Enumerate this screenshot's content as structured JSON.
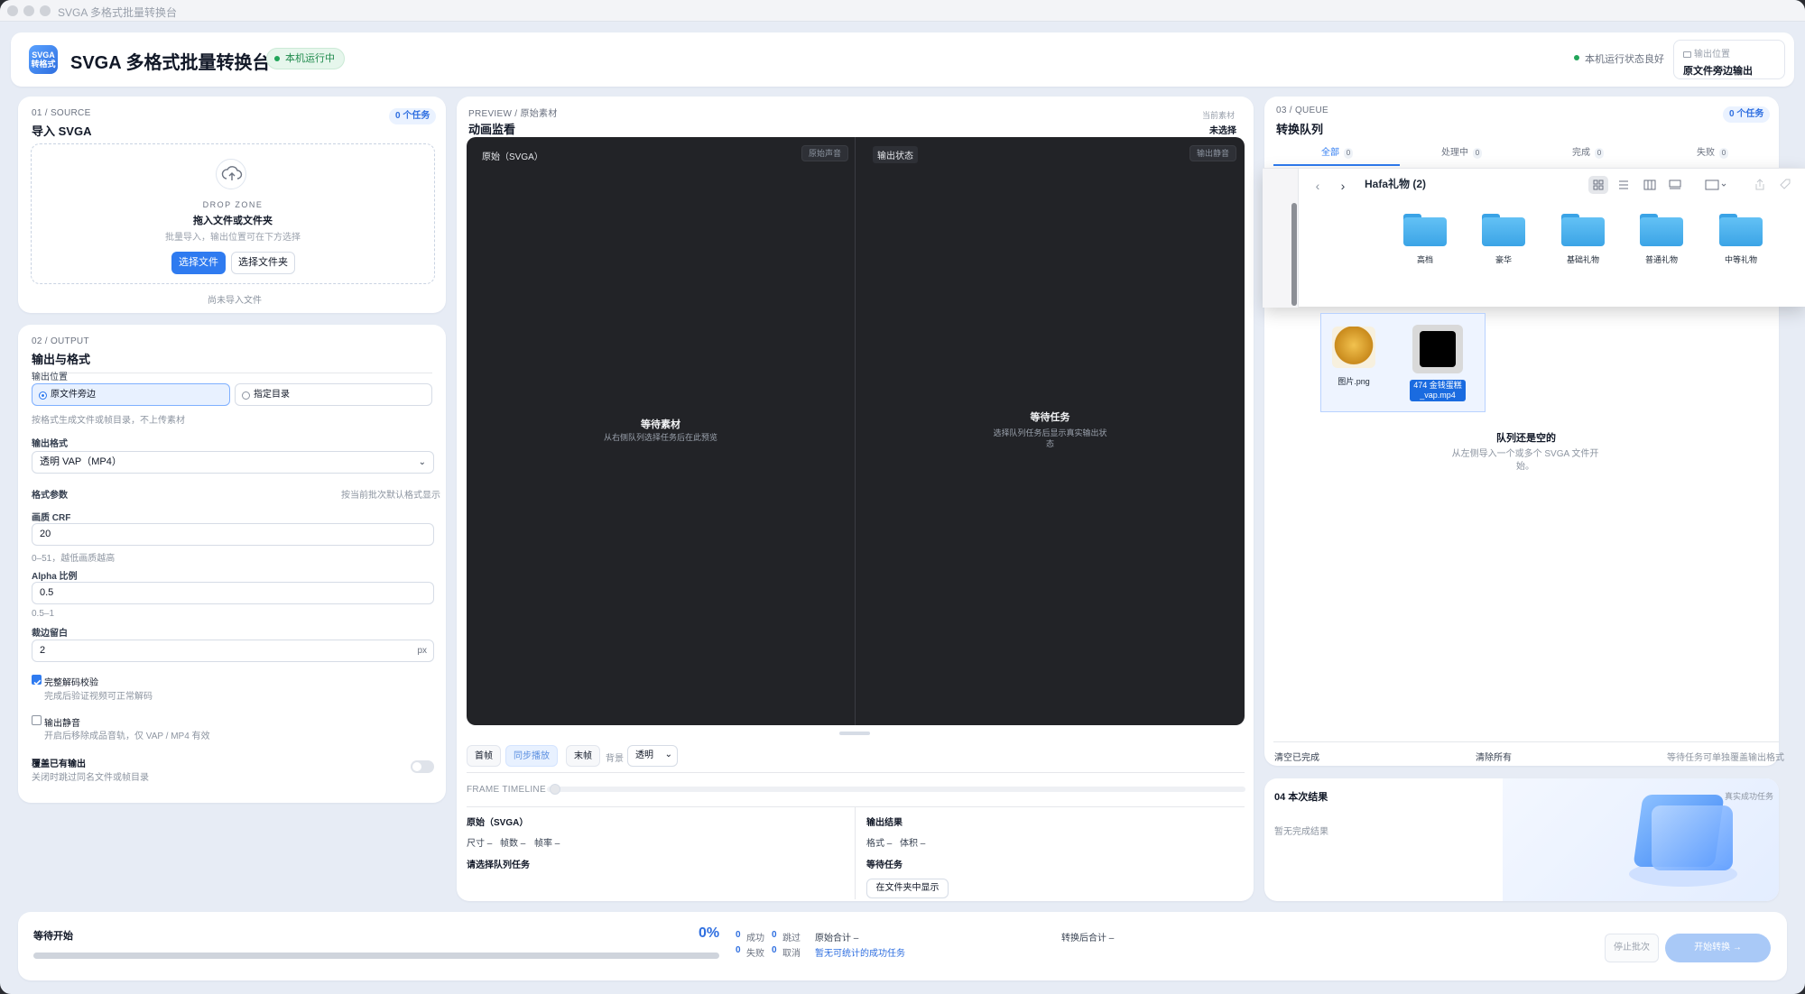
{
  "window": {
    "title": "SVGA 多格式批量转换台"
  },
  "header": {
    "logo_text_1": "SVGA",
    "logo_text_2": "转格式",
    "title": "SVGA 多格式批量转换台",
    "status_pill": "本机运行中",
    "health": "本机运行状态良好",
    "output_location_label": "输出位置",
    "output_location_value": "原文件旁边输出"
  },
  "source": {
    "kicker": "01 / SOURCE",
    "title": "导入 SVGA",
    "task_badge": "0 个任务",
    "dz_kicker": "DROP ZONE",
    "dz_title": "拖入文件或文件夹",
    "dz_sub": "批量导入，输出位置可在下方选择",
    "btn_files": "选择文件",
    "btn_folder": "选择文件夹",
    "empty": "尚未导入文件"
  },
  "output": {
    "kicker": "02 / OUTPUT",
    "title": "输出与格式",
    "location_label": "输出位置",
    "radio_beside": "原文件旁边",
    "radio_dir": "指定目录",
    "location_hint": "按格式生成文件或帧目录，不上传素材",
    "format_label": "输出格式",
    "format_value": "透明 VAP（MP4）",
    "params_label": "格式参数",
    "params_hint": "按当前批次默认格式显示",
    "crf_label": "画质 CRF",
    "crf_value": "20",
    "crf_hint": "0–51，越低画质越高",
    "alpha_label": "Alpha 比例",
    "alpha_value": "0.5",
    "alpha_hint": "0.5–1",
    "crop_label": "裁边留白",
    "crop_value": "2",
    "crop_unit": "px",
    "verify_label": "完整解码校验",
    "verify_hint": "完成后验证视频可正常解码",
    "verify_checked": true,
    "mute_label": "输出静音",
    "mute_hint": "开启后移除成品音轨，仅 VAP / MP4 有效",
    "mute_checked": false,
    "overwrite_label": "覆盖已有输出",
    "overwrite_hint": "关闭时跳过同名文件或帧目录",
    "overwrite_on": false
  },
  "preview": {
    "kicker": "PREVIEW / 原始素材",
    "title": "动画监看",
    "current_label": "当前素材",
    "current_value": "未选择",
    "left_title": "原始（SVGA）",
    "left_chip": "原始声音",
    "left_msg": "等待素材",
    "left_sub": "从右侧队列选择任务后在此预览",
    "right_title": "输出状态",
    "right_chip": "输出静音",
    "right_msg": "等待任务",
    "right_sub_1": "选择队列任务后显示真实输出状",
    "right_sub_2": "态",
    "btn_first": "首帧",
    "btn_sync": "同步播放",
    "btn_last": "末帧",
    "bg_label": "背景",
    "bg_value": "透明",
    "timeline_label": "FRAME TIMELINE",
    "src_title": "原始（SVGA）",
    "src_size": "尺寸",
    "src_frames": "帧数",
    "src_fps": "帧率",
    "dash": "–",
    "src_hint": "请选择队列任务",
    "out_title": "输出结果",
    "out_format": "格式",
    "out_volume": "体积",
    "out_status": "等待任务",
    "out_btn": "在文件夹中显示"
  },
  "queue": {
    "kicker": "03 / QUEUE",
    "title": "转换队列",
    "task_badge": "0 个任务",
    "tabs": [
      {
        "label": "全部",
        "count": "0"
      },
      {
        "label": "处理中",
        "count": "0"
      },
      {
        "label": "完成",
        "count": "0"
      },
      {
        "label": "失败",
        "count": "0"
      }
    ],
    "empty_title": "队列还是空的",
    "empty_sub_1": "从左侧导入一个或多个 SVGA 文件开",
    "empty_sub_2": "始。",
    "clear_done": "清空已完成",
    "clear_all": "清除所有",
    "hint": "等待任务可单独覆盖输出格式"
  },
  "results": {
    "title": "04 本次结果",
    "tag": "真实成功任务",
    "empty": "暂无完成结果"
  },
  "finder": {
    "title": "Hafa礼物 (2)",
    "folders": [
      "高档",
      "豪华",
      "基础礼物",
      "普通礼物",
      "中等礼物"
    ],
    "drag_file_1": "图片.png",
    "drag_file_2_line1": "474 金钱蛋糕",
    "drag_file_2_line2": "_vap.mp4"
  },
  "footer": {
    "status": "等待开始",
    "percent": "0%",
    "progress": 0,
    "success_count": "0",
    "success_label": "成功",
    "skip_count": "0",
    "skip_label": "跳过",
    "fail_count": "0",
    "fail_label": "失败",
    "cancel_count": "0",
    "cancel_label": "取消",
    "orig_total": "原始合计 –",
    "no_stats": "暂无可统计的成功任务",
    "conv_total": "转换后合计 –",
    "btn_stop": "停止批次",
    "btn_start": "开始转换 →"
  },
  "colors": {
    "accent": "#2f7bf0",
    "running": "#22a55a",
    "stage": "#222327"
  }
}
